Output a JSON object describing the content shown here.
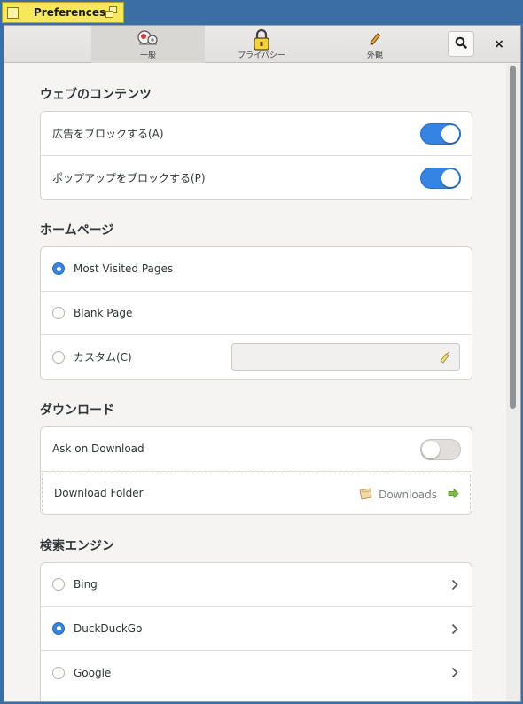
{
  "window": {
    "title": "Preferences"
  },
  "tabs": [
    {
      "label": "一般",
      "icon": "general-icon",
      "active": true
    },
    {
      "label": "プライバシー",
      "icon": "privacy-lock-icon",
      "active": false
    },
    {
      "label": "外観",
      "icon": "appearance-pencil-icon",
      "active": false
    }
  ],
  "header_buttons": {
    "search_icon": "search-icon",
    "close_glyph": "×"
  },
  "sections": {
    "web_content": {
      "title": "ウェブのコンテンツ",
      "rows": [
        {
          "label": "広告をブロックする(A)",
          "enabled": true
        },
        {
          "label": "ポップアップをブロックする(P)",
          "enabled": true
        }
      ]
    },
    "homepage": {
      "title": "ホームページ",
      "options": [
        {
          "label": "Most Visited Pages",
          "selected": true
        },
        {
          "label": "Blank Page",
          "selected": false
        },
        {
          "label": "カスタム(C)",
          "selected": false
        }
      ],
      "custom_url_value": ""
    },
    "download": {
      "title": "ダウンロード",
      "ask_on_download": {
        "label": "Ask on Download",
        "enabled": false
      },
      "download_folder": {
        "label": "Download Folder",
        "value": "Downloads"
      }
    },
    "search_engine": {
      "title": "検索エンジン",
      "options": [
        {
          "label": "Bing",
          "selected": false
        },
        {
          "label": "DuckDuckGo",
          "selected": true
        },
        {
          "label": "Google",
          "selected": false
        }
      ]
    }
  },
  "colors": {
    "accent": "#3584e4",
    "title_tab": "#f6e85a",
    "desktop": "#3a6ea5"
  }
}
